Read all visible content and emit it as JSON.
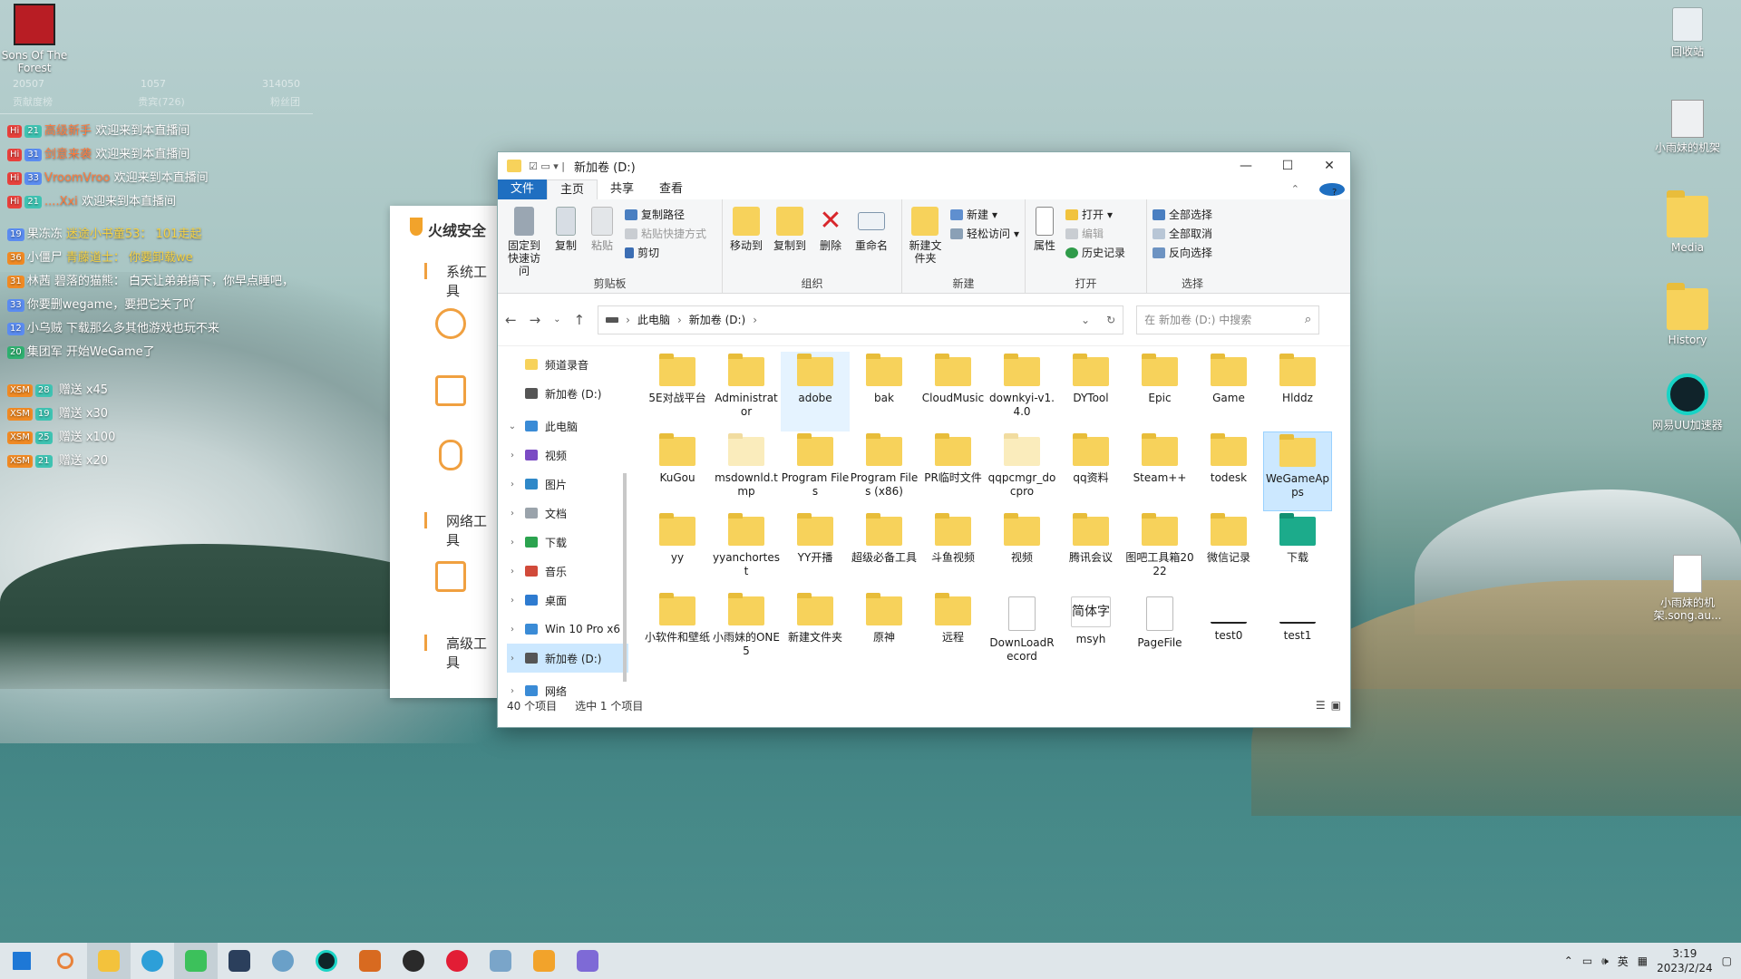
{
  "desktop": {
    "icons_left": [
      {
        "label": "Sons Of The Forest"
      }
    ],
    "icons_right": [
      {
        "label": "回收站"
      },
      {
        "label": "小雨妹的机架"
      },
      {
        "label": "Media"
      },
      {
        "label": "History"
      },
      {
        "label": "网易UU加速器"
      },
      {
        "label": "小雨妹的机架.song.au..."
      }
    ]
  },
  "live_chat": {
    "stats": [
      "20507",
      "1057",
      "314050"
    ],
    "tabs": [
      "贡献度榜",
      "贵宾(726)",
      "粉丝团"
    ],
    "lines": [
      {
        "level": "21",
        "user": "高级新手",
        "text": "欢迎来到本直播间"
      },
      {
        "level": "31",
        "user": "剑意来袭",
        "text": "欢迎来到本直播间"
      },
      {
        "level": "33",
        "user": "VroomVroo",
        "text": "欢迎来到本直播间"
      },
      {
        "level": "21",
        "user": "....Xxi",
        "text": "欢迎来到本直播间"
      },
      {
        "level": "19",
        "user": "果冻冻",
        "text": "迷途小书童53： 101走起"
      },
      {
        "level": "36",
        "user": "小僵尸",
        "text": "青藤道士： 你要卸载we"
      },
      {
        "level": "31",
        "user": "林茜",
        "text": "碧落的猫熊： 白天让弟弟搞下，你早点睡吧，"
      },
      {
        "level": "33",
        "user": "",
        "text": "你要删wegame，要把它关了吖"
      },
      {
        "level": "12",
        "user": "小乌贼",
        "text": "下载那么多其他游戏也玩不来"
      },
      {
        "level": "20",
        "user": "集团军",
        "text": "开始WeGame了"
      },
      {
        "level": "28",
        "user": "XSM",
        "text": "赠送 x45"
      },
      {
        "level": "19",
        "user": "XSM",
        "text": "赠送 x30"
      },
      {
        "level": "25",
        "user": "XSM",
        "text": "赠送 x100"
      },
      {
        "level": "21",
        "user": "XSM",
        "text": "赠送 x20"
      }
    ]
  },
  "huorong": {
    "title": "火绒安全",
    "items": [
      "系统工具",
      "网络工具",
      "高级工具"
    ]
  },
  "explorer": {
    "title": "新加卷 (D:)",
    "window_controls": [
      "—",
      "☐",
      "✕"
    ],
    "tabs": [
      "文件",
      "主页",
      "共享",
      "查看"
    ],
    "ribbon": {
      "clipboard": {
        "label": "剪贴板",
        "pin": "固定到快速访问",
        "copy": "复制",
        "paste": "粘贴",
        "copy_path": "复制路径",
        "paste_shortcut": "粘贴快捷方式",
        "cut": "剪切"
      },
      "organize": {
        "label": "组织",
        "move_to": "移动到",
        "copy_to": "复制到",
        "delete": "删除",
        "rename": "重命名"
      },
      "new": {
        "label": "新建",
        "new_folder": "新建文件夹",
        "new_item": "新建",
        "easy_access": "轻松访问"
      },
      "open": {
        "label": "打开",
        "properties": "属性",
        "open": "打开",
        "edit": "编辑",
        "history": "历史记录"
      },
      "select": {
        "label": "选择",
        "select_all": "全部选择",
        "select_none": "全部取消",
        "invert": "反向选择"
      }
    },
    "breadcrumb": [
      "此电脑",
      "新加卷 (D:)"
    ],
    "search_placeholder": "在 新加卷 (D:) 中搜索",
    "nav": [
      {
        "label": "频道录音",
        "chev": ""
      },
      {
        "label": "新加卷 (D:)",
        "chev": ""
      },
      {
        "label": "此电脑",
        "chev": "⌄"
      },
      {
        "label": "视频",
        "chev": "›"
      },
      {
        "label": "图片",
        "chev": "›"
      },
      {
        "label": "文档",
        "chev": "›"
      },
      {
        "label": "下载",
        "chev": "›"
      },
      {
        "label": "音乐",
        "chev": "›"
      },
      {
        "label": "桌面",
        "chev": "›"
      },
      {
        "label": "Win 10 Pro x6",
        "chev": "›"
      },
      {
        "label": "新加卷 (D:)",
        "chev": "›"
      },
      {
        "label": "网络",
        "chev": "›"
      }
    ],
    "files": [
      "5E对战平台",
      "Administrator",
      "adobe",
      "bak",
      "CloudMusic",
      "downkyi-v1.4.0",
      "DYTool",
      "Epic",
      "Game",
      "Hlddz",
      "KuGou",
      "msdownld.tmp",
      "Program Files",
      "Program Files (x86)",
      "PR临时文件",
      "qqpcmgr_docpro",
      "qq资料",
      "Steam++",
      "todesk",
      "WeGameApps",
      "yy",
      "yyanchortest",
      "YY开播",
      "超级必备工具",
      "斗鱼视频",
      "视频",
      "腾讯会议",
      "图吧工具箱2022",
      "微信记录",
      "下载",
      "小软件和壁纸",
      "小雨妹的ONE5",
      "新建文件夹",
      "原神",
      "远程",
      "DownLoadRecord",
      "msyh",
      "PageFile",
      "test0",
      "test1"
    ],
    "font_preview": "简体字",
    "status_count": "40 个项目",
    "status_selected": "选中 1 个项目"
  },
  "taskbar": {
    "time": "3:19",
    "date": "2023/2/24",
    "ime": "英"
  }
}
